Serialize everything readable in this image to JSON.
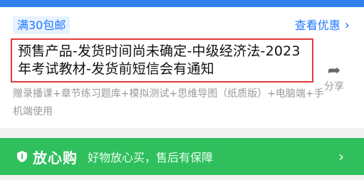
{
  "promo": {
    "badge": "满30包邮",
    "offer_link": "查看优惠"
  },
  "product": {
    "title": "预售产品-发货时间尚未确定-中级经济法-2023年考试教材-发货前短信会有通知",
    "description": "赠录播课+章节练习题库+模拟测试+思维导图（纸质版）+电脑端+手机端使用"
  },
  "share": {
    "label": "分享",
    "icon": "share-arrow-icon"
  },
  "assurance": {
    "brand": "放心购",
    "slogan": "好物放心买，售后有保障",
    "icon": "shield-icon"
  },
  "colors": {
    "accent_blue": "#1f78ff",
    "green": "#2fbf5d",
    "highlight_red": "#e23b3b"
  }
}
